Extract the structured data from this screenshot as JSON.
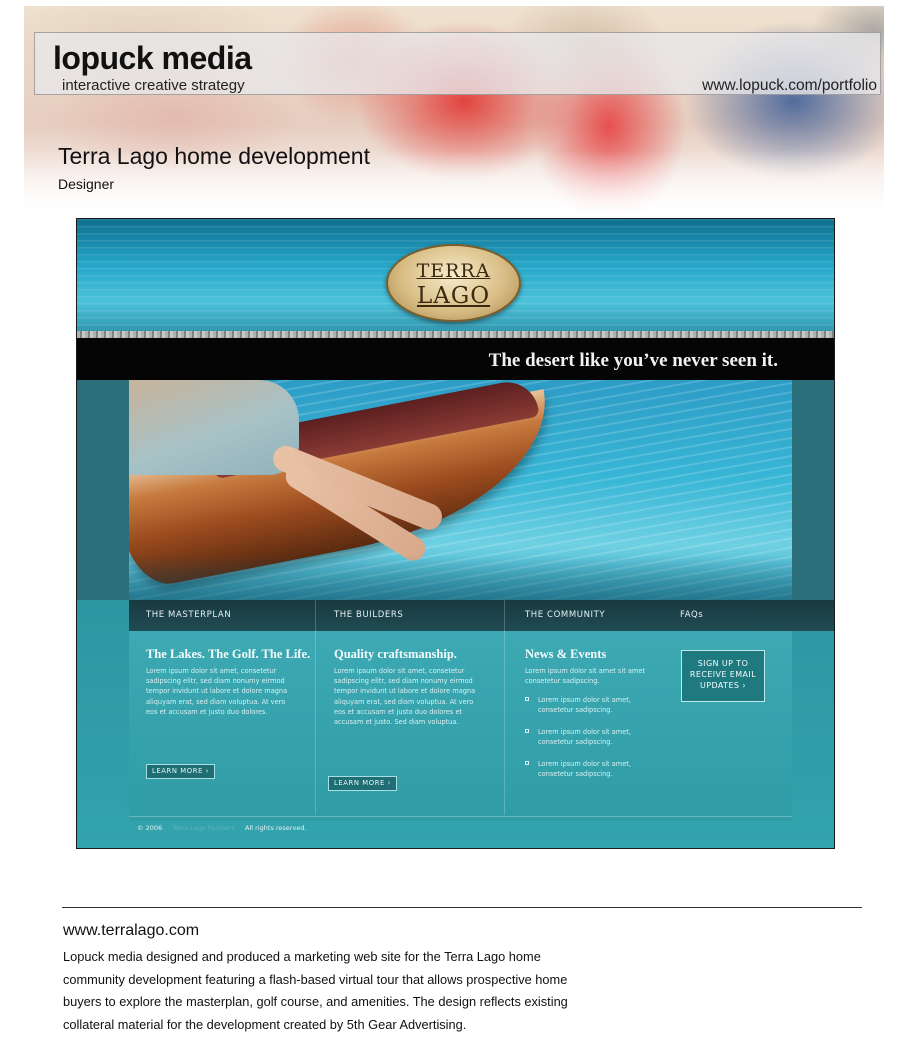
{
  "header": {
    "brand": "lopuck media",
    "tagline": "interactive creative strategy",
    "portfolio_url": "www.lopuck.com/portfolio",
    "project_title": "Terra Lago home development",
    "project_role": "Designer"
  },
  "site": {
    "logo_line1": "TERRA",
    "logo_line2": "LAGO",
    "tagline": "The desert like you’ve never seen it.",
    "nav": [
      "THE MASTERPLAN",
      "THE BUILDERS",
      "THE COMMUNITY",
      "FAQs"
    ],
    "columns": [
      {
        "heading": "The Lakes. The Golf. The Life.",
        "body": "Lorem ipsum dolor sit amet, consetetur sadipscing elitr, sed diam nonumy eirmod tempor invidunt ut labore et dolore magna aliquyam erat, sed diam voluptua. At vero eos et accusam et justo duo dolores.",
        "button": "LEARN MORE ›"
      },
      {
        "heading": "Quality craftsmanship.",
        "body": "Lorem ipsum dolor sit amet, consetetur sadipscing elitr, sed diam nonumy eirmod tempor invidunt ut labore et dolore magna aliquyam erat, sed diam voluptua. At vero eos et accusam et justo duo dolores et accusam et justo. Sed diam voluptua.",
        "button": "LEARN MORE ›"
      },
      {
        "heading": "News & Events",
        "intro": "Lorem ipsum dolor sit amet sit amet consetetur sadipscing.",
        "items": [
          "Lorem ipsum dolor sit amet, consetetur sadipscing.",
          "Lorem ipsum dolor sit amet, consetetur sadipscing.",
          "Lorem ipsum dolor sit amet, consetetur sadipscing."
        ]
      }
    ],
    "signup": [
      "SIGN UP TO",
      "RECEIVE EMAIL",
      "UPDATES ›"
    ],
    "footer_year": "© 2006",
    "footer_link": "Terra Lago Partners",
    "footer_rights": "All rights reserved."
  },
  "description": {
    "url": "www.terralago.com",
    "body": "Lopuck media designed and produced a marketing web site for the Terra Lago home community development featuring a flash-based virtual tour that allows prospective home buyers to explore the masterplan, golf course, and amenities. The design reflects existing collateral material for the development created by 5th Gear Advertising."
  },
  "colors": {
    "site_teal": "#2c96a1",
    "tagline_bar": "#050505",
    "nav_bar": "#183a40",
    "logo_gold": "#d9be86"
  }
}
